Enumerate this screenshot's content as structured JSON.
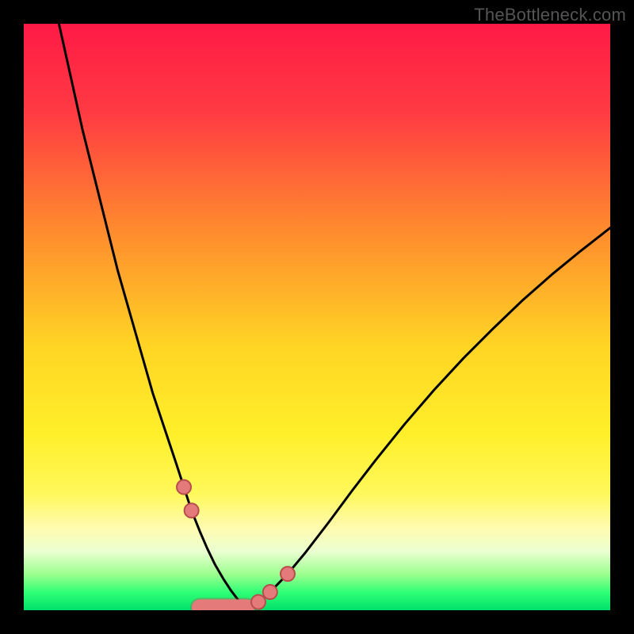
{
  "watermark": "TheBottleneck.com",
  "colors": {
    "frame": "#000000",
    "gradient_stops": [
      {
        "offset": 0.0,
        "color": "#ff1a45"
      },
      {
        "offset": 0.15,
        "color": "#ff3a43"
      },
      {
        "offset": 0.35,
        "color": "#ff8a2e"
      },
      {
        "offset": 0.55,
        "color": "#ffd524"
      },
      {
        "offset": 0.7,
        "color": "#ffef2a"
      },
      {
        "offset": 0.8,
        "color": "#fff85a"
      },
      {
        "offset": 0.86,
        "color": "#fffbb0"
      },
      {
        "offset": 0.9,
        "color": "#eaffd0"
      },
      {
        "offset": 0.94,
        "color": "#98ff8d"
      },
      {
        "offset": 0.97,
        "color": "#2eff76"
      },
      {
        "offset": 1.0,
        "color": "#00e06a"
      }
    ],
    "curve": "#000000",
    "markers_fill": "#e47a7a",
    "markers_stroke": "#b84d4d"
  },
  "chart_data": {
    "type": "line",
    "title": "",
    "xlabel": "",
    "ylabel": "",
    "xlim": [
      0,
      100
    ],
    "ylim": [
      0,
      100
    ],
    "series": [
      {
        "name": "left-curve",
        "x": [
          6,
          8,
          10,
          12,
          14,
          16,
          18,
          20,
          22,
          24,
          26,
          27.3,
          28.6,
          30,
          31.3,
          32.6,
          34,
          35.3,
          36.6,
          38
        ],
        "y": [
          100,
          91,
          82,
          74,
          66,
          58,
          51,
          44,
          37,
          31,
          25,
          21,
          17,
          13.5,
          10.5,
          7.8,
          5.4,
          3.4,
          1.7,
          0.6
        ]
      },
      {
        "name": "right-curve",
        "x": [
          38,
          40,
          42,
          45,
          48,
          52,
          56,
          60,
          65,
          70,
          75,
          80,
          85,
          90,
          95,
          100
        ],
        "y": [
          0.6,
          1.4,
          3.1,
          6.2,
          9.8,
          15.0,
          20.4,
          25.6,
          31.8,
          37.6,
          43.0,
          48.0,
          52.8,
          57.2,
          61.3,
          65.2
        ]
      }
    ],
    "markers": {
      "left": {
        "x": [
          27.3,
          28.6
        ],
        "y": [
          21,
          17
        ]
      },
      "right": {
        "x": [
          40,
          42,
          45
        ],
        "y": [
          1.4,
          3.1,
          6.2
        ]
      },
      "bottom_segment": {
        "x0": 30,
        "x1": 38,
        "y": 0.9
      }
    }
  }
}
